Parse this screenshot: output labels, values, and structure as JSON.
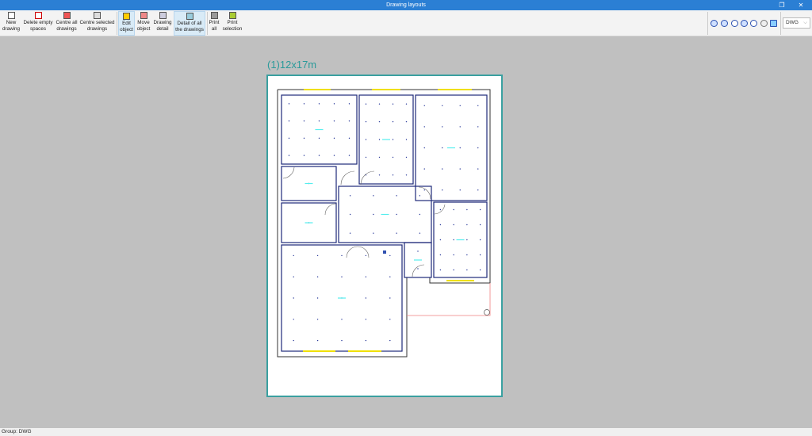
{
  "window": {
    "title": "Drawing layouts",
    "restore_icon": "restore-icon",
    "close_icon": "close-icon"
  },
  "toolbar": {
    "buttons": [
      {
        "l1": "New",
        "l2": "drawing"
      },
      {
        "l1": "Delete empty",
        "l2": "spaces"
      },
      {
        "l1": "Centre all",
        "l2": "drawings"
      },
      {
        "l1": "Centre selected",
        "l2": "drawings"
      },
      {
        "l1": "Edit",
        "l2": "object"
      },
      {
        "l1": "Move",
        "l2": "object"
      },
      {
        "l1": "Drawing",
        "l2": "detail"
      },
      {
        "l1": "Detail of all",
        "l2": "the drawings"
      },
      {
        "l1": "Print",
        "l2": "all"
      },
      {
        "l1": "Print",
        "l2": "selection"
      }
    ],
    "format_select": "DWG",
    "format_chevron": "⌵"
  },
  "sheet": {
    "title": "(1)12x17m"
  },
  "status": {
    "text": "Group: DWG"
  },
  "colors": {
    "title_bar": "#2b7fd4",
    "sheet_border": "#3aa0a0",
    "wall": "#333333",
    "room": "#1e2a7a",
    "window": "#f0e000",
    "boundary": "#f08080"
  }
}
